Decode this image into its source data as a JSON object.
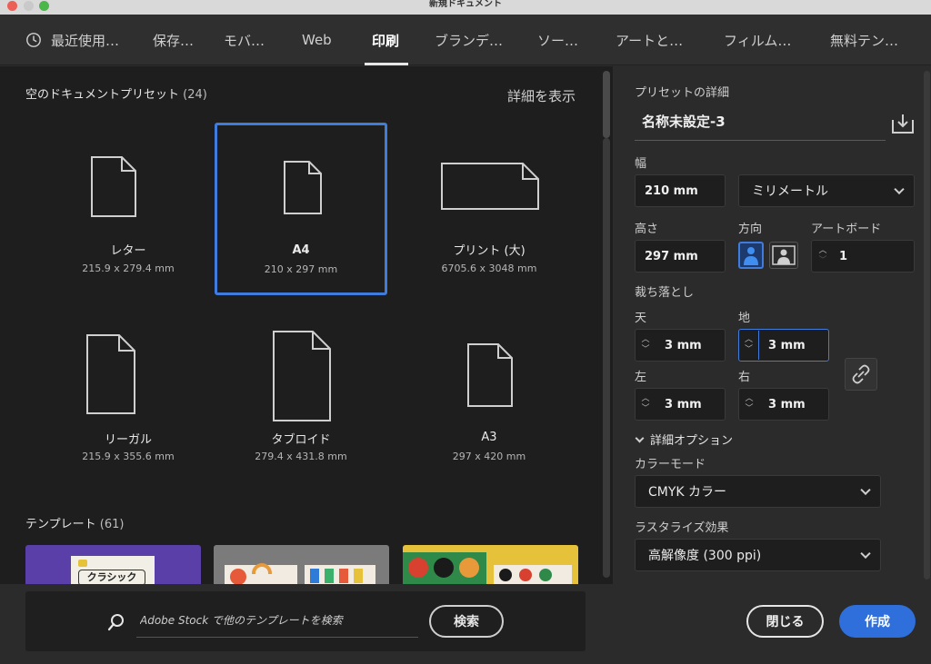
{
  "window": {
    "title": "新規ドキュメント"
  },
  "tabs": [
    {
      "label": "最近使用…"
    },
    {
      "label": "保存…"
    },
    {
      "label": "モバ…"
    },
    {
      "label": "Web"
    },
    {
      "label": "印刷",
      "active": true
    },
    {
      "label": "ブランデ…"
    },
    {
      "label": "ソー…"
    },
    {
      "label": "アートと…"
    },
    {
      "label": "フィルム…"
    },
    {
      "label": "無料テン…"
    }
  ],
  "presets_section": {
    "title": "空のドキュメントプリセット",
    "count": "(24)",
    "show_details": "詳細を表示",
    "items": [
      {
        "name": "レター",
        "size": "215.9 x 279.4 mm",
        "icon": "portrait-document-icon"
      },
      {
        "name": "A4",
        "size": "210 x 297 mm",
        "icon": "portrait-document-icon",
        "selected": true
      },
      {
        "name": "プリント (大)",
        "size": "6705.6 x 3048 mm",
        "icon": "landscape-document-icon"
      },
      {
        "name": "リーガル",
        "size": "215.9 x 355.6 mm",
        "icon": "portrait-document-icon"
      },
      {
        "name": "タブロイド",
        "size": "279.4 x 431.8 mm",
        "icon": "portrait-document-icon"
      },
      {
        "name": "A3",
        "size": "297 x 420 mm",
        "icon": "portrait-document-icon"
      }
    ]
  },
  "templates_section": {
    "title": "テンプレート",
    "count": "(61)",
    "thumb1_text": "クラシック"
  },
  "search": {
    "placeholder": "Adobe Stock で他のテンプレートを検索",
    "button": "検索"
  },
  "preset_details": {
    "heading": "プリセットの詳細",
    "name": "名称未設定-3",
    "width_label": "幅",
    "width": "210 mm",
    "unit": "ミリメートル",
    "height_label": "高さ",
    "height": "297 mm",
    "orientation_label": "方向",
    "artboards_label": "アートボード",
    "artboards": "1",
    "bleed_label": "裁ち落とし",
    "bleed_top_label": "天",
    "bleed_top": "3 mm",
    "bleed_bottom_label": "地",
    "bleed_bottom": "3 mm",
    "bleed_left_label": "左",
    "bleed_left": "3 mm",
    "bleed_right_label": "右",
    "bleed_right": "3 mm",
    "advanced_label": "詳細オプション",
    "color_mode_label": "カラーモード",
    "color_mode": "CMYK カラー",
    "raster_label": "ラスタライズ効果",
    "raster": "高解像度 (300 ppi)"
  },
  "actions": {
    "close": "閉じる",
    "create": "作成"
  },
  "colors": {
    "accent": "#3f7cdc",
    "create_button": "#2f6fdb"
  }
}
